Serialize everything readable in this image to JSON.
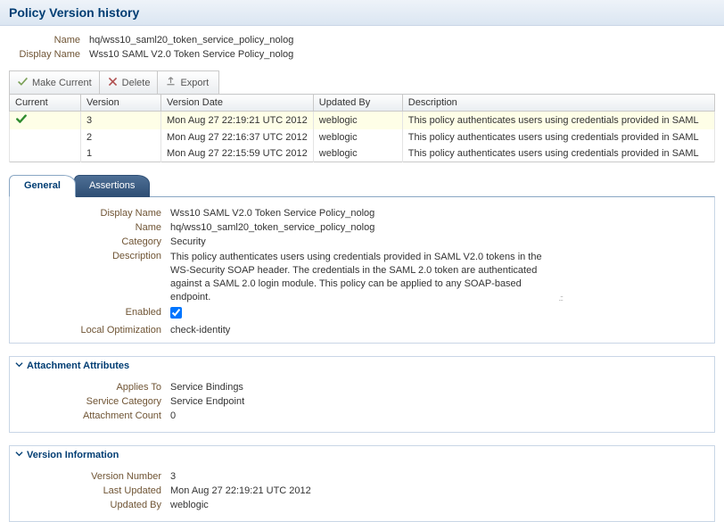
{
  "header": {
    "title": "Policy Version history"
  },
  "summary": {
    "name_label": "Name",
    "name_value": "hq/wss10_saml20_token_service_policy_nolog",
    "display_name_label": "Display Name",
    "display_name_value": "Wss10 SAML V2.0 Token Service Policy_nolog"
  },
  "toolbar": {
    "make_current": "Make Current",
    "delete": "Delete",
    "export": "Export"
  },
  "table": {
    "cols": {
      "current": "Current",
      "version": "Version",
      "version_date": "Version Date",
      "updated_by": "Updated By",
      "description": "Description"
    },
    "rows": [
      {
        "current": true,
        "version": "3",
        "date": "Mon Aug 27 22:19:21 UTC 2012",
        "updated_by": "weblogic",
        "desc": "This policy authenticates users using credentials provided in SAML"
      },
      {
        "current": false,
        "version": "2",
        "date": "Mon Aug 27 22:16:37 UTC 2012",
        "updated_by": "weblogic",
        "desc": "This policy authenticates users using credentials provided in SAML"
      },
      {
        "current": false,
        "version": "1",
        "date": "Mon Aug 27 22:15:59 UTC 2012",
        "updated_by": "weblogic",
        "desc": "This policy authenticates users using credentials provided in SAML"
      }
    ]
  },
  "tabs": {
    "general": "General",
    "assertions": "Assertions"
  },
  "general": {
    "display_name_label": "Display Name",
    "display_name_value": "Wss10 SAML V2.0 Token Service Policy_nolog",
    "name_label": "Name",
    "name_value": "hq/wss10_saml20_token_service_policy_nolog",
    "category_label": "Category",
    "category_value": "Security",
    "description_label": "Description",
    "description_value": "This policy authenticates users using credentials provided in SAML V2.0 tokens in the WS-Security SOAP header. The credentials in the SAML 2.0 token are authenticated against a SAML 2.0 login module. This policy can be applied to any SOAP-based endpoint.",
    "enabled_label": "Enabled",
    "local_opt_label": "Local Optimization",
    "local_opt_value": "check-identity"
  },
  "attachment": {
    "title": "Attachment Attributes",
    "applies_to_label": "Applies To",
    "applies_to_value": "Service Bindings",
    "service_cat_label": "Service Category",
    "service_cat_value": "Service Endpoint",
    "count_label": "Attachment Count",
    "count_value": "0"
  },
  "version_info": {
    "title": "Version Information",
    "number_label": "Version Number",
    "number_value": "3",
    "last_updated_label": "Last Updated",
    "last_updated_value": "Mon Aug 27 22:19:21 UTC 2012",
    "updated_by_label": "Updated By",
    "updated_by_value": "weblogic"
  }
}
